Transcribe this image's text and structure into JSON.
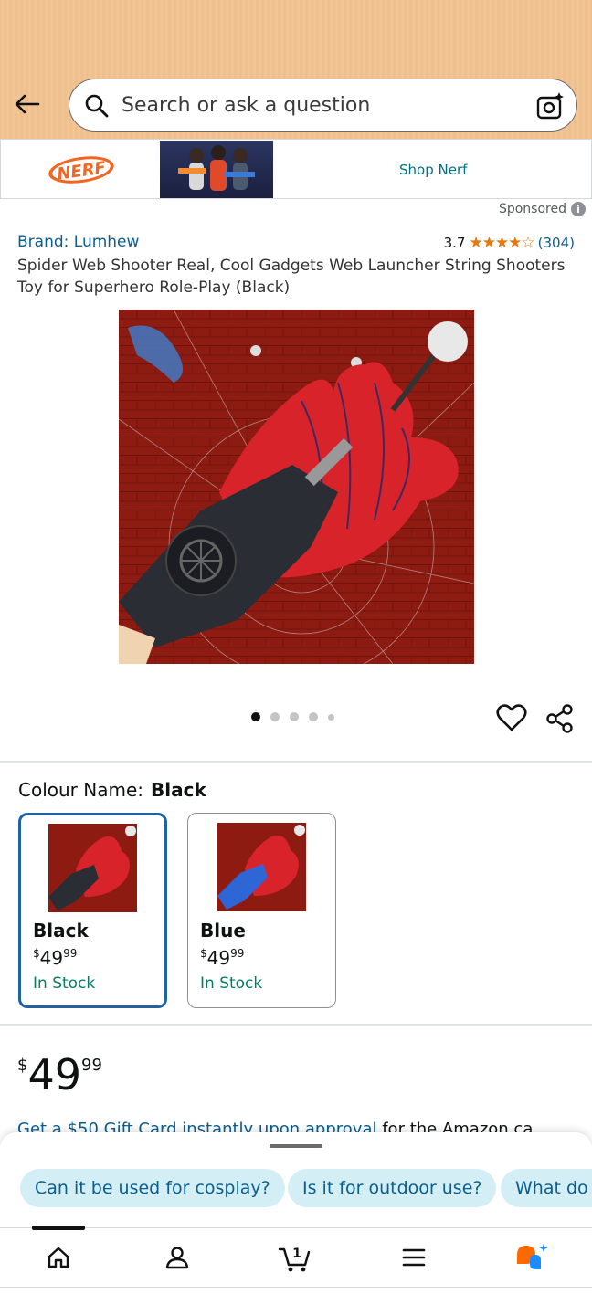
{
  "header": {
    "search_placeholder": "Search or ask a question"
  },
  "sponsored_banner": {
    "brand_logo_text": "NERF",
    "link_label": "Shop Nerf",
    "sponsored_label": "Sponsored"
  },
  "product": {
    "brand": "Brand: Lumhew",
    "rating_value": "3.7",
    "rating_stars": 3.7,
    "rating_stars_display": "★★★★☆",
    "rating_count": "(304)",
    "title": "Spider Web Shooter Real, Cool Gadgets Web Launcher String Shooters Toy for Superhero Role-Play (Black)",
    "image_count": 5,
    "active_image": 1
  },
  "colour": {
    "label": "Colour Name:",
    "selected": "Black",
    "variants": [
      {
        "name": "Black",
        "currency": "$",
        "whole": "49",
        "fraction": "99",
        "stock": "In Stock",
        "selected": true
      },
      {
        "name": "Blue",
        "currency": "$",
        "whole": "49",
        "fraction": "99",
        "stock": "In Stock",
        "selected": false
      }
    ]
  },
  "price": {
    "currency": "$",
    "whole": "49",
    "fraction": "99"
  },
  "promo": {
    "link_text": "Get a $50 Gift Card instantly upon approval",
    "rest_text": " for the Amazon ca"
  },
  "suggestions": [
    "Can it be used for cosplay?",
    "Is it for outdoor use?",
    "What do"
  ],
  "nav": {
    "items": [
      "home-icon",
      "account-icon",
      "cart-icon",
      "menu-icon",
      "rufus-icon"
    ],
    "cart_count": "1"
  },
  "colors": {
    "header_bg": "#f0c08f",
    "link": "#0a5e8f",
    "in_stock": "#067d62",
    "selected_border": "#2162a1",
    "chip_bg": "#d4eef6",
    "star": "#e47911"
  }
}
